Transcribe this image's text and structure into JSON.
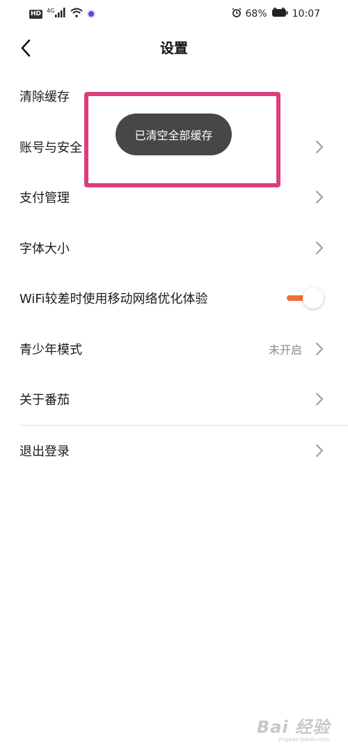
{
  "status_bar": {
    "hd_badge": "HD",
    "network": "4G",
    "battery": "68%",
    "time": "10:07"
  },
  "header": {
    "title": "设置",
    "back_icon": "chevron-left-icon"
  },
  "settings": {
    "clear_cache": {
      "label": "清除缓存"
    },
    "account_security": {
      "label": "账号与安全"
    },
    "payment": {
      "label": "支付管理"
    },
    "font_size": {
      "label": "字体大小"
    },
    "wifi_optimize": {
      "label": "WiFi较差时使用移动网络优化体验",
      "enabled": true
    },
    "teen_mode": {
      "label": "青少年模式",
      "value": "未开启"
    },
    "about": {
      "label": "关于番茄"
    },
    "logout": {
      "label": "退出登录"
    }
  },
  "toast": {
    "message": "已清空全部缓存"
  },
  "colors": {
    "accent": "#f07030",
    "highlight": "#dc3d7c",
    "toast_bg": "#474747"
  },
  "watermark": {
    "logo": "Bai 经验",
    "url": "jingyan.baidu.com"
  }
}
